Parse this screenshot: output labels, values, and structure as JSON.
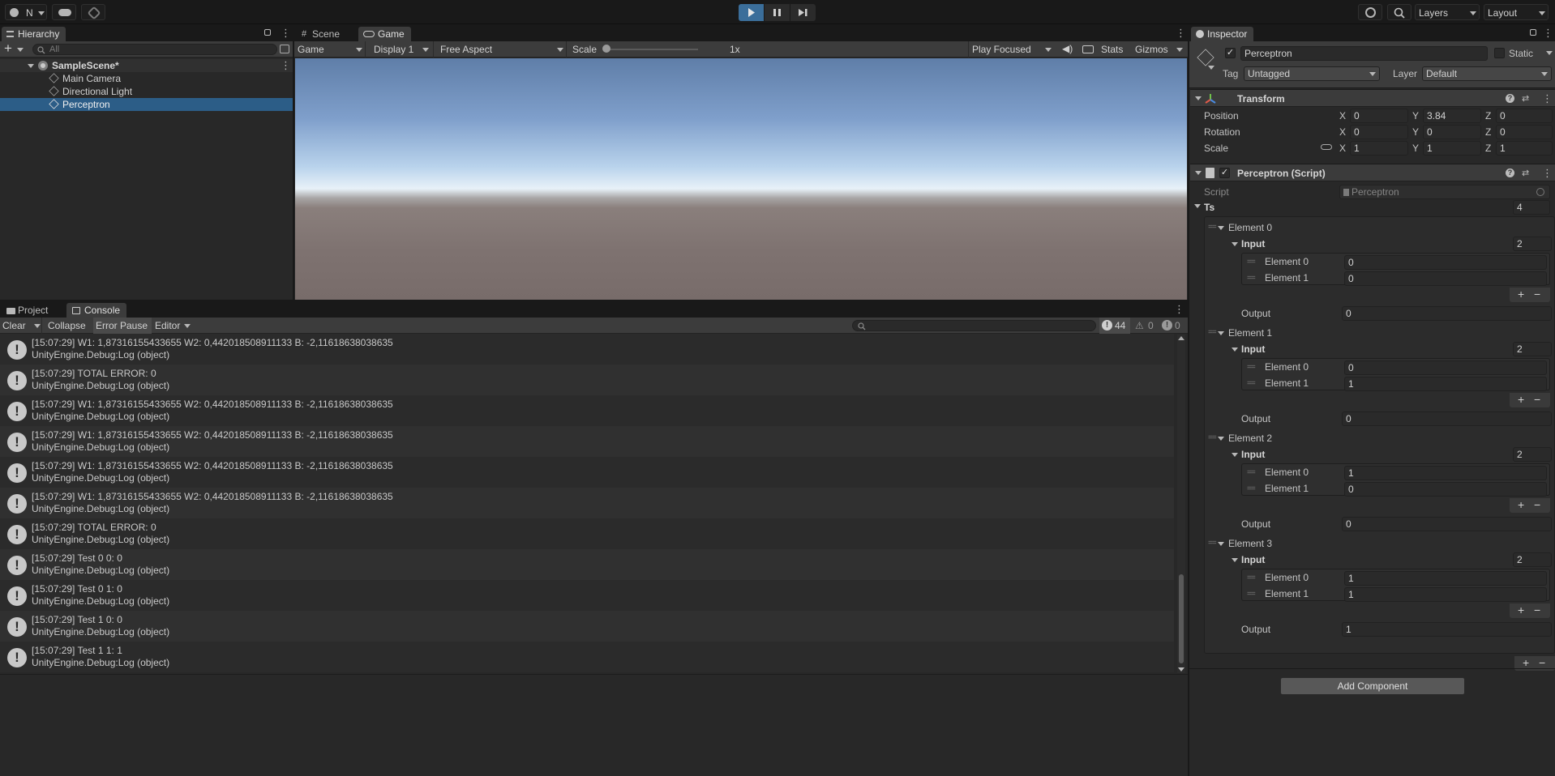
{
  "toolbar": {
    "account_label": "N",
    "layers_label": "Layers",
    "layout_label": "Layout"
  },
  "hierarchy": {
    "tab_label": "Hierarchy",
    "search_placeholder": "All",
    "scene_name": "SampleScene*",
    "items": [
      {
        "label": "Main Camera"
      },
      {
        "label": "Directional Light"
      },
      {
        "label": "Perceptron"
      }
    ]
  },
  "game_view": {
    "tabs": [
      {
        "label": "Scene"
      },
      {
        "label": "Game"
      }
    ],
    "mode": "Game",
    "display": "Display 1",
    "aspect": "Free Aspect",
    "scale_label": "Scale",
    "scale_value": "1x",
    "play_focused": "Play Focused",
    "stats_label": "Stats",
    "gizmos_label": "Gizmos"
  },
  "console": {
    "tabs": [
      {
        "label": "Project"
      },
      {
        "label": "Console"
      }
    ],
    "clear_label": "Clear",
    "collapse_label": "Collapse",
    "error_pause_label": "Error Pause",
    "editor_label": "Editor",
    "log_count": "44",
    "warning_count": "0",
    "error_count": "0",
    "entries": [
      {
        "line1": "[15:07:29] W1: 1,87316155433655 W2: 0,442018508911133 B: -2,11618638038635",
        "line2": "UnityEngine.Debug:Log (object)"
      },
      {
        "line1": "[15:07:29] TOTAL ERROR: 0",
        "line2": "UnityEngine.Debug:Log (object)"
      },
      {
        "line1": "[15:07:29] W1: 1,87316155433655 W2: 0,442018508911133 B: -2,11618638038635",
        "line2": "UnityEngine.Debug:Log (object)"
      },
      {
        "line1": "[15:07:29] W1: 1,87316155433655 W2: 0,442018508911133 B: -2,11618638038635",
        "line2": "UnityEngine.Debug:Log (object)"
      },
      {
        "line1": "[15:07:29] W1: 1,87316155433655 W2: 0,442018508911133 B: -2,11618638038635",
        "line2": "UnityEngine.Debug:Log (object)"
      },
      {
        "line1": "[15:07:29] W1: 1,87316155433655 W2: 0,442018508911133 B: -2,11618638038635",
        "line2": "UnityEngine.Debug:Log (object)"
      },
      {
        "line1": "[15:07:29] TOTAL ERROR: 0",
        "line2": "UnityEngine.Debug:Log (object)"
      },
      {
        "line1": "[15:07:29] Test 0 0: 0",
        "line2": "UnityEngine.Debug:Log (object)"
      },
      {
        "line1": "[15:07:29] Test 0 1: 0",
        "line2": "UnityEngine.Debug:Log (object)"
      },
      {
        "line1": "[15:07:29] Test 1 0: 0",
        "line2": "UnityEngine.Debug:Log (object)"
      },
      {
        "line1": "[15:07:29] Test 1 1: 1",
        "line2": "UnityEngine.Debug:Log (object)"
      }
    ]
  },
  "inspector": {
    "tab_label": "Inspector",
    "object_name": "Perceptron",
    "static_label": "Static",
    "tag_label": "Tag",
    "tag_value": "Untagged",
    "layer_label": "Layer",
    "layer_value": "Default",
    "transform": {
      "title": "Transform",
      "position_label": "Position",
      "rotation_label": "Rotation",
      "scale_label": "Scale",
      "x": "X",
      "y": "Y",
      "z": "Z",
      "position": [
        "0",
        "3.84",
        "0"
      ],
      "rotation": [
        "0",
        "0",
        "0"
      ],
      "scale": [
        "1",
        "1",
        "1"
      ]
    },
    "script_component": {
      "title": "Perceptron (Script)",
      "script_label": "Script",
      "script_value": "Perceptron",
      "ts_label": "Ts",
      "ts_size": "4",
      "input_label": "Input",
      "output_label": "Output",
      "elements": [
        {
          "label": "Element 0",
          "input_size": "2",
          "inputs": [
            {
              "label": "Element 0",
              "value": "0"
            },
            {
              "label": "Element 1",
              "value": "0"
            }
          ],
          "output": "0"
        },
        {
          "label": "Element 1",
          "input_size": "2",
          "inputs": [
            {
              "label": "Element 0",
              "value": "0"
            },
            {
              "label": "Element 1",
              "value": "1"
            }
          ],
          "output": "0"
        },
        {
          "label": "Element 2",
          "input_size": "2",
          "inputs": [
            {
              "label": "Element 0",
              "value": "1"
            },
            {
              "label": "Element 1",
              "value": "0"
            }
          ],
          "output": "0"
        },
        {
          "label": "Element 3",
          "input_size": "2",
          "inputs": [
            {
              "label": "Element 0",
              "value": "1"
            },
            {
              "label": "Element 1",
              "value": "1"
            }
          ],
          "output": "1"
        }
      ]
    },
    "add_component_label": "Add Component"
  }
}
